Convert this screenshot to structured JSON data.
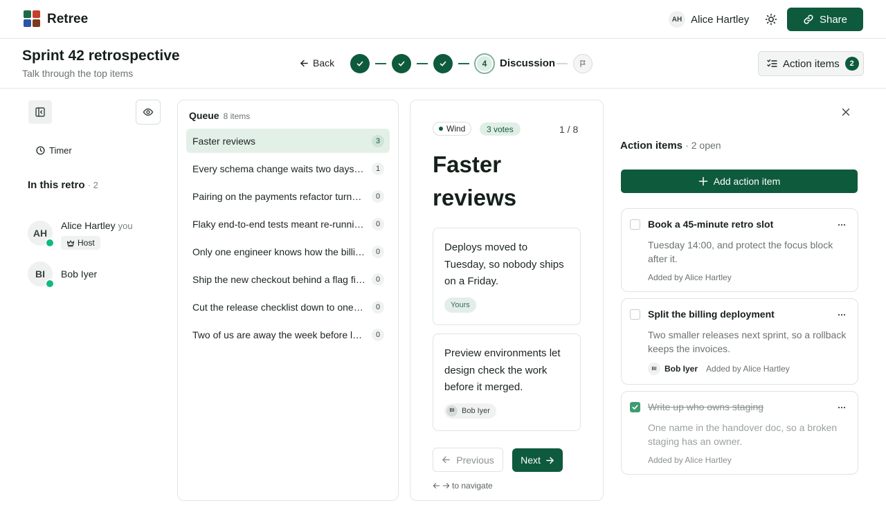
{
  "app": {
    "name": "Retree"
  },
  "header": {
    "user": {
      "initials": "AH",
      "name": "Alice Hartley"
    },
    "share_label": "Share"
  },
  "retro": {
    "title": "Sprint 42 retrospective",
    "subtitle": "Talk through the top items",
    "back_label": "Back",
    "current_step_number": "4",
    "current_step_label": "Discussion"
  },
  "action_toggle": {
    "label": "Action items",
    "count": "2"
  },
  "sidebar": {
    "timer_label": "Timer",
    "in_retro_label": "In this retro",
    "in_retro_count": "· 2",
    "participants": [
      {
        "initials": "AH",
        "name": "Alice Hartley",
        "you": "you",
        "role": "Host"
      },
      {
        "initials": "BI",
        "name": "Bob Iyer"
      }
    ]
  },
  "queue": {
    "title": "Queue",
    "count_label": "8 items",
    "items": [
      {
        "text": "Faster reviews",
        "votes": "3"
      },
      {
        "text": "Every schema change waits two days for a reviewer",
        "votes": "1"
      },
      {
        "text": "Pairing on the payments refactor turned out well",
        "votes": "0"
      },
      {
        "text": "Flaky end-to-end tests meant re-running the pipeline",
        "votes": "0"
      },
      {
        "text": "Only one engineer knows how the billing service works",
        "votes": "0"
      },
      {
        "text": "Ship the new checkout behind a flag first",
        "votes": "0"
      },
      {
        "text": "Cut the release checklist down to one page",
        "votes": "0"
      },
      {
        "text": "Two of us are away the week before launch",
        "votes": "0"
      }
    ]
  },
  "discussion": {
    "category": "Wind",
    "votes": "3 votes",
    "position": "1 / 8",
    "title": "Faster reviews",
    "notes": [
      {
        "text": "Deploys moved to Tuesday, so nobody ships on a Friday.",
        "tag": "Yours"
      },
      {
        "text": "Preview environments let design check the work before it merged.",
        "author_initials": "BI",
        "author": "Bob Iyer"
      }
    ],
    "prev_label": "Previous",
    "next_label": "Next",
    "nav_hint": "to navigate"
  },
  "action_items": {
    "title": "Action items",
    "open_count": "· 2 open",
    "add_label": "Add action item",
    "items": [
      {
        "title": "Book a 45-minute retro slot",
        "description": "Tuesday 14:00, and protect the focus block after it.",
        "added_by": "Added by Alice Hartley",
        "done": false
      },
      {
        "title": "Split the billing deployment",
        "description": "Two smaller releases next sprint, so a rollback keeps the invoices.",
        "assignee_initials": "BI",
        "assignee": "Bob Iyer",
        "added_by": "Added by Alice Hartley",
        "done": false
      },
      {
        "title": "Write up who owns staging",
        "description": "One name in the handover doc, so a broken staging has an owner.",
        "added_by": "Added by Alice Hartley",
        "done": true
      }
    ]
  },
  "colors": {
    "primary": "#0e5a3c",
    "online": "#10b981",
    "done_check": "#3f9c72"
  },
  "icons": [
    "logo-icon",
    "sun-icon",
    "link-icon",
    "arrow-left-icon",
    "check-icon",
    "flag-icon",
    "checklist-icon",
    "sidebar-collapse-icon",
    "eye-icon",
    "clock-icon",
    "crown-icon",
    "arrow-right-icon",
    "close-icon",
    "plus-icon",
    "more-icon"
  ]
}
